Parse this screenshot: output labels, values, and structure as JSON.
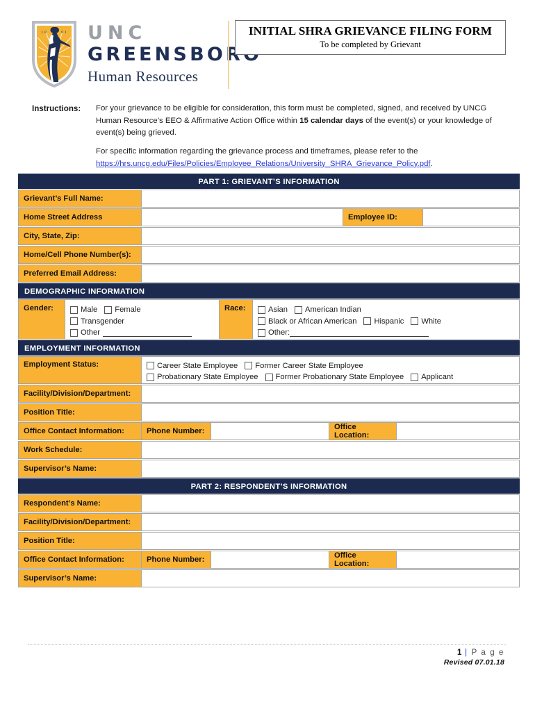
{
  "header": {
    "logo": {
      "icon": "uncg-minerva-shield-logo",
      "unc": "UNC",
      "greensboro": "GREENSBORO",
      "unit": "Human Resources",
      "shield_gold": "#f5b335",
      "shield_navy": "#1f2f55"
    },
    "title_main": "INITIAL SHRA GRIEVANCE FILING FORM",
    "title_sub": "To be completed by Grievant"
  },
  "instructions": {
    "label": "Instructions:",
    "p1_a": "For your grievance to be eligible for consideration, this form must be completed, signed, and received by UNCG Human Resource’s EEO & Affirmative Action Office within ",
    "p1_bold": "15 calendar days",
    "p1_b": " of the event(s) or your knowledge of event(s) being grieved.",
    "p2": "For specific information regarding the grievance process and timeframes, please refer to the",
    "link": "https://hrs.uncg.edu/Files/Policies/Employee_Relations/University_SHRA_Grievance_Policy.pdf",
    "link_suffix": "."
  },
  "part1": {
    "header": "PART 1:  GRIEVANT’S INFORMATION",
    "rows": [
      {
        "label": "Grievant’s Full Name:",
        "value": ""
      },
      {
        "label": "Home Street Address",
        "value": "",
        "label2": "Employee ID:",
        "value2": ""
      },
      {
        "label": "City, State, Zip:",
        "value": ""
      },
      {
        "label": "Home/Cell Phone Number(s):",
        "value": ""
      },
      {
        "label": "Preferred Email Address:",
        "value": ""
      }
    ],
    "demographic": {
      "header": "DEMOGRAPHIC INFORMATION",
      "gender_label": "Gender:",
      "gender_options": [
        "Male",
        "Female",
        "Transgender",
        "Other"
      ],
      "gender_other_blank": "",
      "race_label": "Race:",
      "race_options": [
        "Asian",
        "American Indian",
        "Black or African American",
        "Hispanic",
        "White"
      ],
      "race_other_label": "Other:",
      "race_other_blank": ""
    },
    "employment": {
      "header": "EMPLOYMENT INFORMATION",
      "status_label": "Employment Status:",
      "status_options": [
        "Career State Employee",
        "Former Career State Employee",
        "Probationary State Employee",
        "Former Probationary State Employee",
        "Applicant"
      ],
      "rows": [
        {
          "label": "Facility/Division/Department:",
          "value": ""
        },
        {
          "label": "Position Title:",
          "value": ""
        }
      ],
      "contact": {
        "label": "Office Contact Information:",
        "phone_label": "Phone Number:",
        "phone_value": "",
        "location_label": "Office Location:",
        "location_value": ""
      },
      "rows2": [
        {
          "label": "Work Schedule:",
          "value": ""
        },
        {
          "label": "Supervisor’s Name:",
          "value": ""
        }
      ]
    }
  },
  "part2": {
    "header": "PART 2: RESPONDENT’S INFORMATION",
    "rows": [
      {
        "label": "Respondent’s Name:",
        "value": ""
      },
      {
        "label": "Facility/Division/Department:",
        "value": ""
      },
      {
        "label": "Position Title:",
        "value": ""
      }
    ],
    "contact": {
      "label": "Office Contact Information:",
      "phone_label": "Phone Number:",
      "phone_value": "",
      "location_label": "Office Location:",
      "location_value": ""
    },
    "rows2": [
      {
        "label": "Supervisor’s Name:",
        "value": ""
      }
    ]
  },
  "footer": {
    "page_number": "1",
    "page_separator": "|",
    "page_word": "P a g e",
    "revised": "Revised 07.01.18"
  }
}
